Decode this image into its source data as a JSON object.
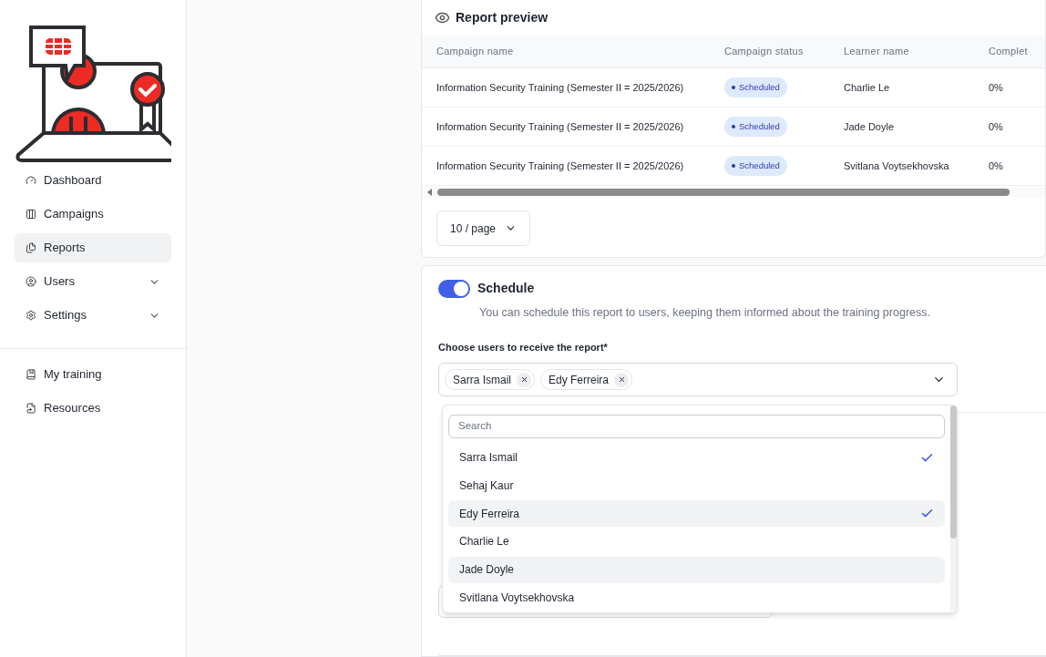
{
  "sidebar": {
    "nav": [
      {
        "label": "Dashboard",
        "selected": false,
        "expandable": false
      },
      {
        "label": "Campaigns",
        "selected": false,
        "expandable": false
      },
      {
        "label": "Reports",
        "selected": true,
        "expandable": false
      },
      {
        "label": "Users",
        "selected": false,
        "expandable": true
      },
      {
        "label": "Settings",
        "selected": false,
        "expandable": true
      }
    ],
    "secondary": [
      {
        "label": "My training",
        "selected": false,
        "expandable": false
      },
      {
        "label": "Resources",
        "selected": false,
        "expandable": false
      }
    ]
  },
  "report_preview": {
    "title": "Report preview",
    "table": {
      "columns": [
        "Campaign name",
        "Campaign status",
        "Learner name",
        "Complet"
      ],
      "rows": [
        {
          "campaign": "Information Security Training (Semester II = 2025/2026)",
          "status": "Scheduled",
          "learner": "Charlie Le",
          "completion": "0%"
        },
        {
          "campaign": "Information Security Training (Semester II = 2025/2026)",
          "status": "Scheduled",
          "learner": "Jade Doyle",
          "completion": "0%"
        },
        {
          "campaign": "Information Security Training (Semester II = 2025/2026)",
          "status": "Scheduled",
          "learner": "Svitlana Voytsekhovska",
          "completion": "0%"
        }
      ]
    },
    "page_size": "10 / page"
  },
  "schedule": {
    "title": "Schedule",
    "on": true,
    "description": "You can schedule this report to users, keeping them informed about the training progress.",
    "recipients_label": "Choose users to receive the report*",
    "selected_users": [
      "Sarra Ismail",
      "Edy Ferreira"
    ],
    "dropdown": {
      "search_placeholder": "Search",
      "options": [
        {
          "label": "Sarra Ismail",
          "selected": true,
          "hovered": false
        },
        {
          "label": "Sehaj Kaur",
          "selected": false,
          "hovered": false
        },
        {
          "label": "Edy Ferreira",
          "selected": true,
          "hovered": true
        },
        {
          "label": "Charlie Le",
          "selected": false,
          "hovered": false
        },
        {
          "label": "Jade Doyle",
          "selected": false,
          "hovered": true
        },
        {
          "label": "Svitlana Voytsekhovska",
          "selected": false,
          "hovered": false
        }
      ]
    }
  }
}
